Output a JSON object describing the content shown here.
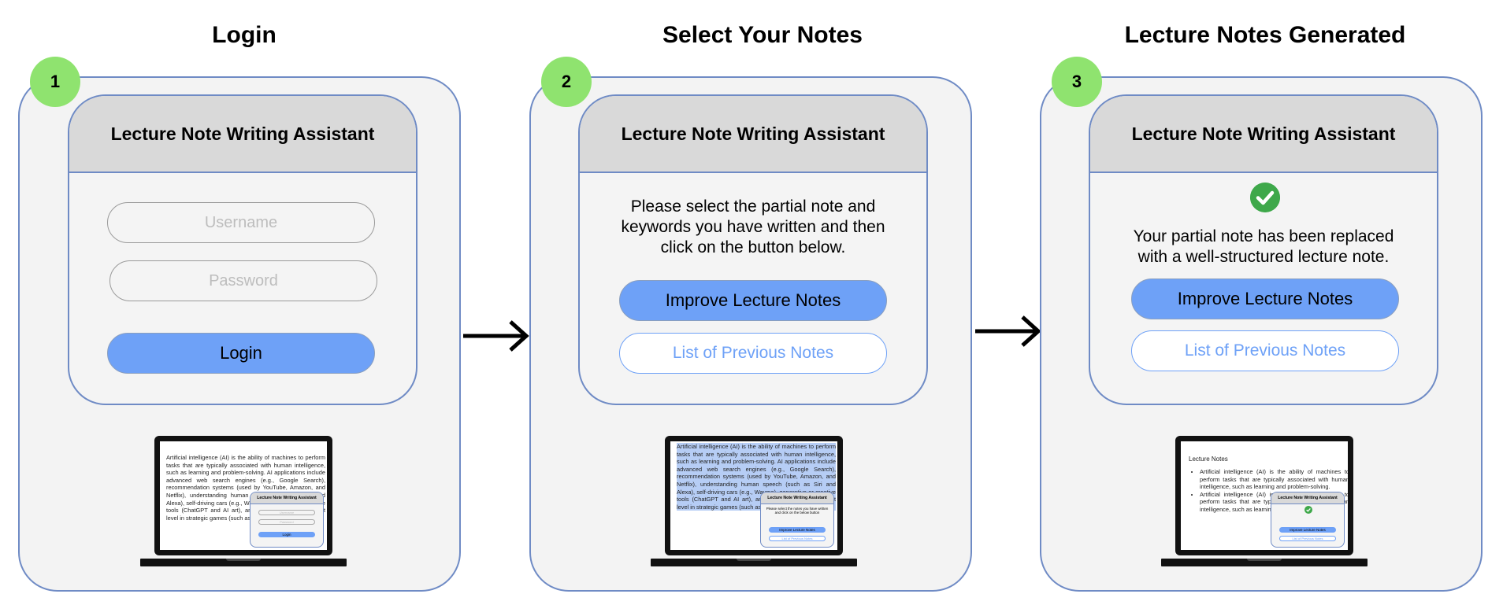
{
  "app_title": "Lecture Note Writing Assistant",
  "steps": [
    {
      "number": "1",
      "title": "Login",
      "username_placeholder": "Username",
      "password_placeholder": "Password",
      "login_button": "Login",
      "laptop": {
        "doc_text": "Artificial intelligence (AI) is the ability of machines to perform tasks that are typically associated with human intelligence, such as learning and problem-solving. AI applications include advanced web search engines (e.g., Google Search), recommendation systems (used by YouTube, Amazon, and Netflix), understanding human speech (such as Siri and Alexa), self-driving cars (e.g., Waymo), generative or creative tools (ChatGPT and AI art), and competing at the highest level in strategic games (such as chess and Go).",
        "mini_username": "Username",
        "mini_password": "Password",
        "mini_login": "Login"
      }
    },
    {
      "number": "2",
      "title": "Select Your Notes",
      "message_lines": [
        "Please select the partial note and",
        "keywords you have written and then",
        "click on the button below."
      ],
      "primary_button": "Improve Lecture Notes",
      "secondary_button": "List of Previous Notes",
      "laptop": {
        "doc_text": "Artificial intelligence (AI) is the ability of machines to perform tasks that are typically associated with human intelligence, such as learning and problem-solving. AI applications include advanced web search engines (e.g., Google Search), recommendation systems (used by YouTube, Amazon, and Netflix), understanding human speech (such as Siri and Alexa), self-driving cars (e.g., Waymo), generative or creative tools (ChatGPT and AI art), and competing at the highest level in strategic games (such as chess and Go).",
        "mini_message": "Please select the notes you have written and click on the below button",
        "mini_primary": "Improve Lecture Notes",
        "mini_secondary": "List of Previous Notes"
      }
    },
    {
      "number": "3",
      "title": "Lecture Notes Generated",
      "message_lines": [
        "Your partial note has been replaced",
        "with a well-structured lecture note."
      ],
      "primary_button": "Improve Lecture Notes",
      "secondary_button": "List of Previous Notes",
      "laptop": {
        "notes_title": "Lecture Notes",
        "bullets": [
          "Artificial intelligence (AI) is the ability of machines to perform tasks that are typically associated with human intelligence, such as learning and problem-solving.",
          "Artificial intelligence (AI) is the ability of machines to perform tasks that are typically associated with human intelligence, such as learning and problem-solving."
        ],
        "mini_primary": "Improve Lecture Notes",
        "mini_secondary": "List of Previous Notes"
      }
    }
  ],
  "colors": {
    "panel_border": "#6f8bc5",
    "badge": "#8fe36f",
    "primary": "#6ea1f7",
    "check": "#3ea84a",
    "highlight": "#b6cdf5"
  }
}
